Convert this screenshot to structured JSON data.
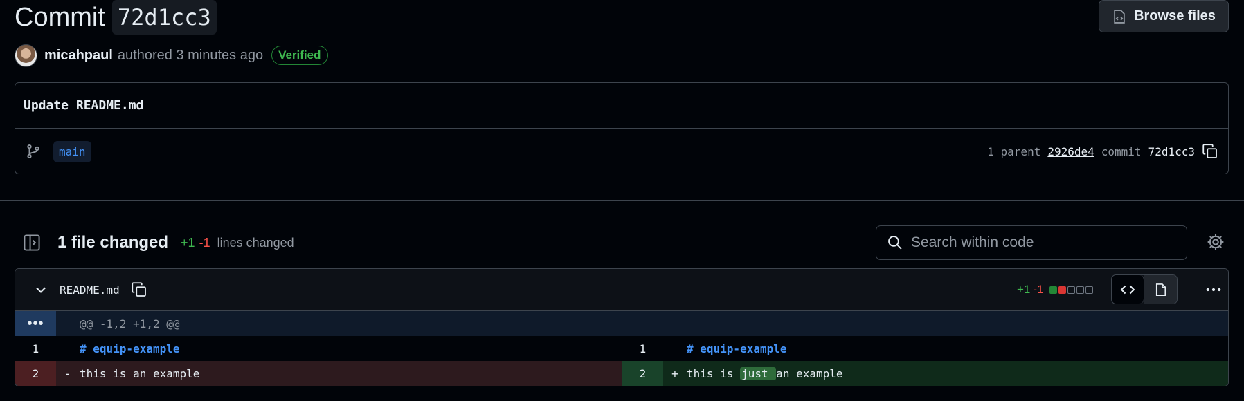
{
  "header": {
    "title": "Commit",
    "sha": "72d1cc3",
    "browse_label": "Browse files",
    "author": "micahpaul",
    "authored_text": "authored 3 minutes ago",
    "verified_label": "Verified"
  },
  "commit": {
    "message": "Update README.md",
    "branch": "main",
    "parent_count_text": "1 parent",
    "parent_sha": "2926de4",
    "commit_label": "commit",
    "commit_sha": "72d1cc3"
  },
  "files_bar": {
    "files_changed": "1 file changed",
    "additions": "+1",
    "deletions": "-1",
    "lines_changed": "lines changed",
    "search_placeholder": "Search within code"
  },
  "diff": {
    "file_name": "README.md",
    "additions": "+1",
    "deletions": "-1",
    "hunk_expand": "•••",
    "hunk_header": "@@ -1,2 +1,2 @@",
    "rows": [
      {
        "left_num": "1",
        "left_mark": "",
        "left_code": "# equip-example",
        "right_num": "1",
        "right_mark": "",
        "right_code": "# equip-example"
      },
      {
        "left_num": "2",
        "left_mark": "-",
        "left_code": "this is an example",
        "right_num": "2",
        "right_mark": "+",
        "right_code_pre": "this is ",
        "right_code_hl": "just ",
        "right_code_post": "an example"
      }
    ]
  },
  "colors": {
    "background": "#010409",
    "addition": "#3fb950",
    "deletion": "#f85149",
    "link": "#4493f8"
  }
}
